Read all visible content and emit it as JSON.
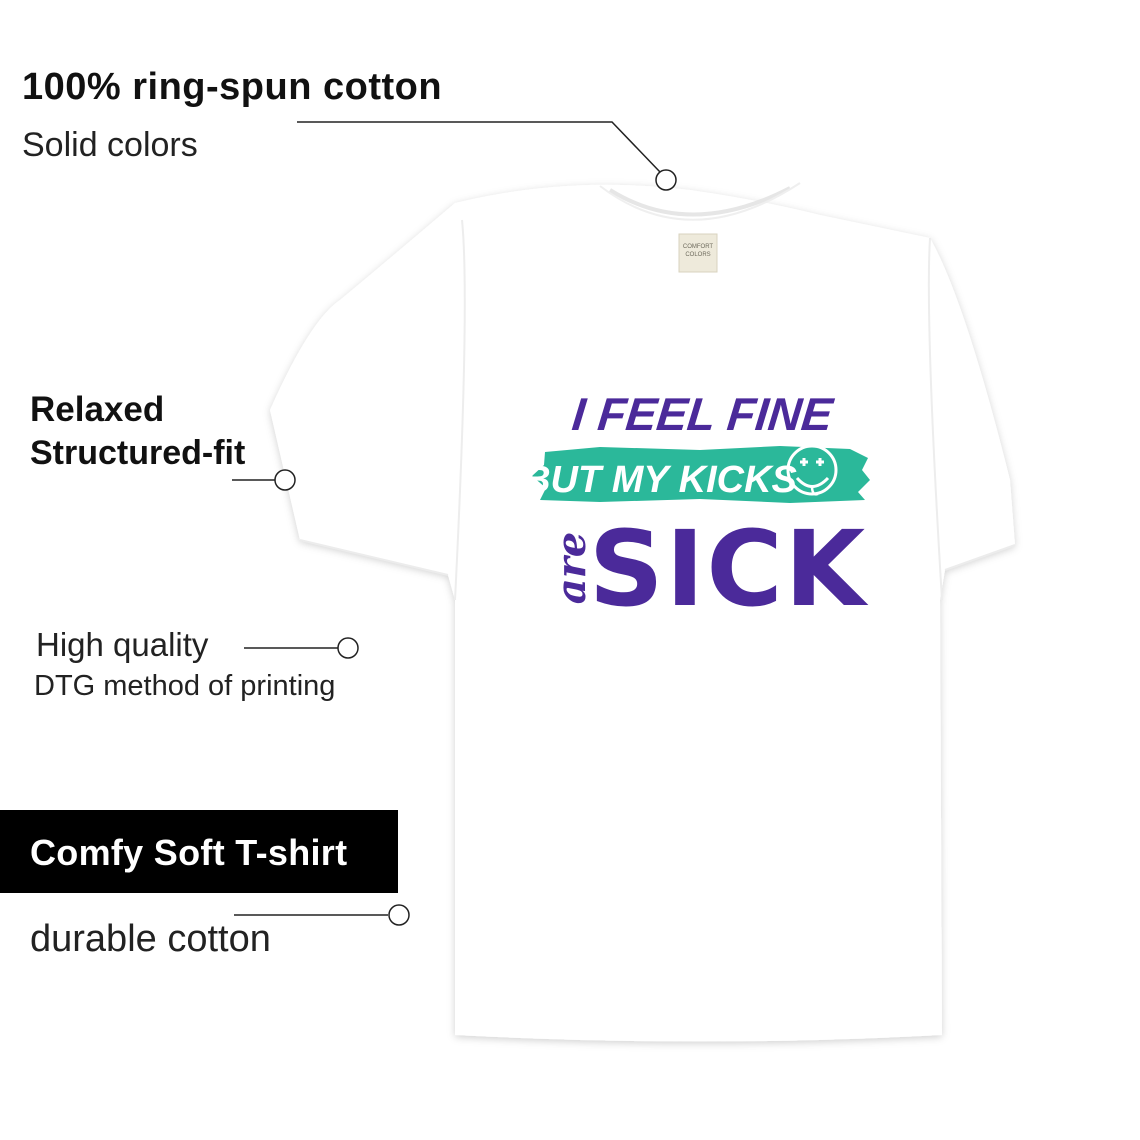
{
  "callouts": {
    "cotton_title": "100% ring-spun cotton",
    "cotton_sub": "Solid colors",
    "fit_title": "Relaxed",
    "fit_sub": "Structured-fit",
    "print_title": "High quality",
    "print_sub": "DTG method of printing",
    "badge_label": "Comfy Soft T-shirt",
    "durable": "durable cotton"
  },
  "shirt": {
    "tag_lines": [
      "COMFORT",
      "COLORS"
    ],
    "print_line1": "I FEEL FINE",
    "print_line2": "BUT MY KICKS",
    "print_line3_script": "are",
    "print_line3": "SICK",
    "colors": {
      "shirt": "#ffffff",
      "purple": "#4b2a9a",
      "teal": "#2bb89a"
    }
  }
}
